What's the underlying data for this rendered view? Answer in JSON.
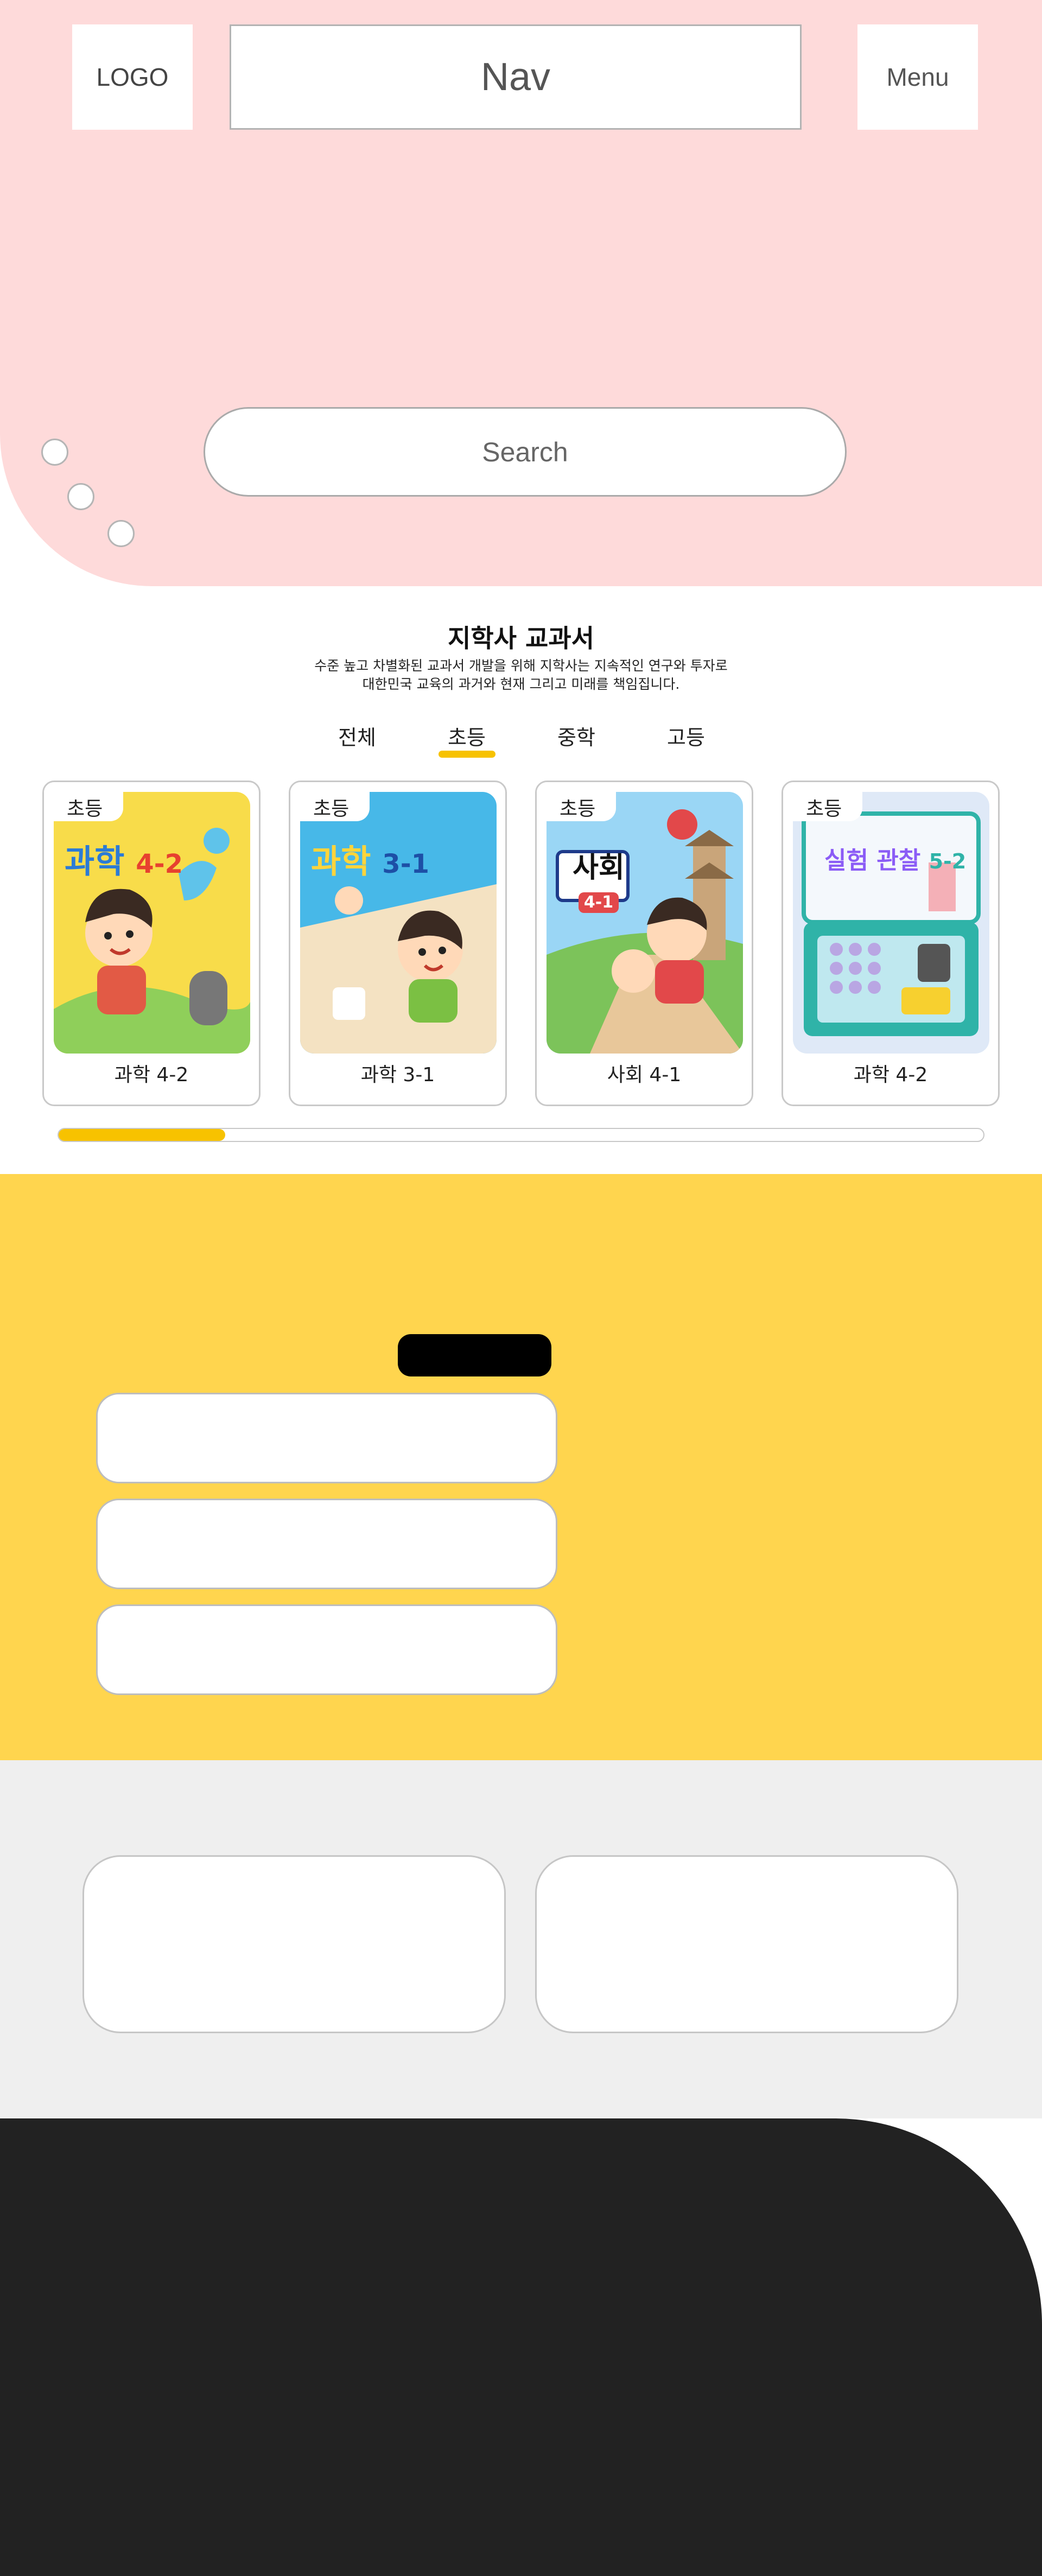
{
  "header": {
    "logo": "LOGO",
    "nav": "Nav",
    "menu": "Menu"
  },
  "hero": {
    "search_placeholder": "Search"
  },
  "textbooks": {
    "title": "지학사 교과서",
    "desc_line1": "수준 높고 차별화된 교과서 개발을 위해 지학사는 지속적인 연구와 투자로",
    "desc_line2": "대한민국 교육의 과거와 현재 그리고 미래를 책임집니다.",
    "tabs": [
      {
        "label": "전체",
        "active": false
      },
      {
        "label": "초등",
        "active": true
      },
      {
        "label": "중학",
        "active": false
      },
      {
        "label": "고등",
        "active": false
      }
    ],
    "cards": [
      {
        "tag": "초등",
        "cover_title": "과학",
        "cover_grade": "4-2",
        "name": "과학 4-2"
      },
      {
        "tag": "초등",
        "cover_title": "과학",
        "cover_grade": "3-1",
        "name": "과학 3-1"
      },
      {
        "tag": "초등",
        "cover_title": "사회",
        "cover_grade": "4-1",
        "name": "사회 4-1"
      },
      {
        "tag": "초등",
        "cover_title": "실험 관찰",
        "cover_grade": "5-2",
        "name": "과학 4-2"
      }
    ],
    "scroll_progress": 0.18
  },
  "colors": {
    "hero_bg": "#fedada",
    "accent_yellow": "#f7c200",
    "section_yellow": "#ffd54e",
    "section_gray": "#efefef",
    "footer_dark": "#222222"
  }
}
